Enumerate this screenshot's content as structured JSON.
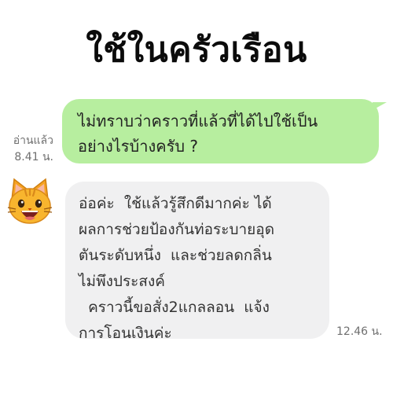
{
  "header": {
    "title": "ใช้ในครัวเรือน"
  },
  "messages": {
    "outgoing": {
      "text": "ไม่ทราบว่าคราวที่แล้วที่ได้ไปใช้เป็น\nอย่างไรบ้างครับ ?",
      "read_label": "อ่านแล้ว",
      "time": "8.41 น."
    },
    "incoming": {
      "avatar_icon": "cat-face-icon",
      "text": "อ่อค่ะ  ใช้แล้วรู้สึกดีมากค่ะ ได้\nผลการช่วยป้องกันท่อระบายอุด\nตันระดับหนึ่ง  และช่วยลดกลิ่น\nไม่พึงประสงค์\n  คราวนี้ขอสั่ง2แกลลอน  แจ้ง\nการโอนเงินค่ะ",
      "time": "12.46 น."
    }
  },
  "colors": {
    "outgoing_bubble": "#b7ee9f",
    "incoming_bubble": "#f0f0f1",
    "meta_text": "#6f6f6f"
  }
}
